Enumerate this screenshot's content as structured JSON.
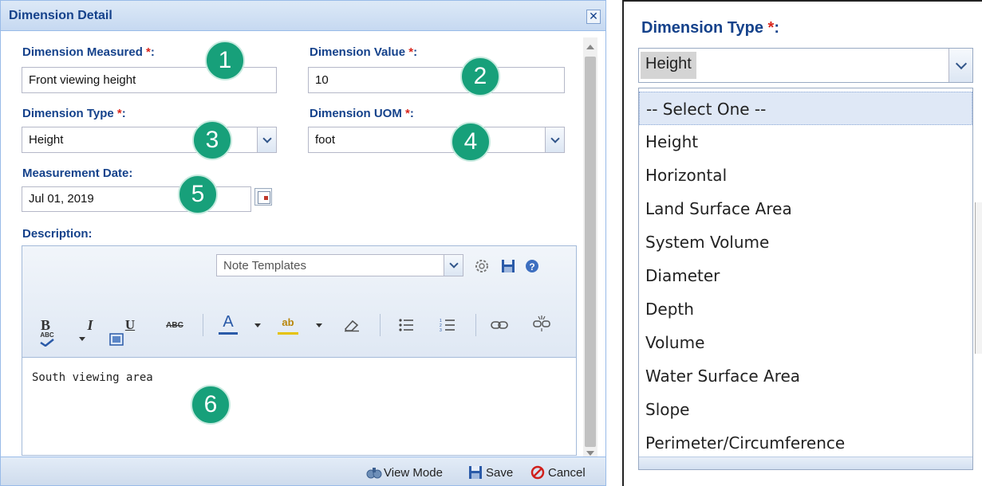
{
  "dialog": {
    "title": "Dimension Detail",
    "close_icon": "close-icon",
    "fields": {
      "measured": {
        "label": "Dimension Measured ",
        "value": "Front viewing height"
      },
      "value": {
        "label": "Dimension Value ",
        "value": "10"
      },
      "type": {
        "label": "Dimension Type ",
        "value": "Height"
      },
      "uom": {
        "label": "Dimension UOM ",
        "value": "foot"
      },
      "date": {
        "label": "Measurement Date:",
        "value": "Jul 01, 2019"
      },
      "description": {
        "label": "Description:"
      }
    },
    "required_marker": "*",
    "label_colon": ":",
    "badges": [
      "1",
      "2",
      "3",
      "4",
      "5",
      "6"
    ],
    "editor": {
      "note_templates": "Note Templates",
      "toolbar_icons": [
        "bold-icon",
        "italic-icon",
        "underline-icon",
        "strikethrough-icon",
        "font-color-icon",
        "highlight-icon",
        "eraser-icon",
        "bullet-list-icon",
        "numbered-list-icon",
        "link-icon",
        "unlink-icon",
        "spellcheck-icon",
        "html-view-icon",
        "settings-icon",
        "save-icon",
        "help-icon"
      ],
      "bold": "B",
      "italic": "I",
      "underline": "U",
      "strike": "ABC",
      "font_color": "A",
      "highlight": "ab",
      "spell": "ABC",
      "body": "South viewing area"
    },
    "footer": {
      "view_mode": "View Mode",
      "save": "Save",
      "cancel": "Cancel"
    }
  },
  "dropdown": {
    "label": "Dimension Type ",
    "required_marker": "*",
    "colon": ":",
    "selected": "Height",
    "options": [
      "-- Select One --",
      "Height",
      "Horizontal",
      "Land Surface Area",
      "System Volume",
      "Diameter",
      "Depth",
      "Volume",
      "Water Surface Area",
      "Slope",
      "Perimeter/Circumference"
    ],
    "highlighted_index": 0
  },
  "colors": {
    "label": "#15428b",
    "required": "#d9261c",
    "badge": "#17a07a"
  }
}
